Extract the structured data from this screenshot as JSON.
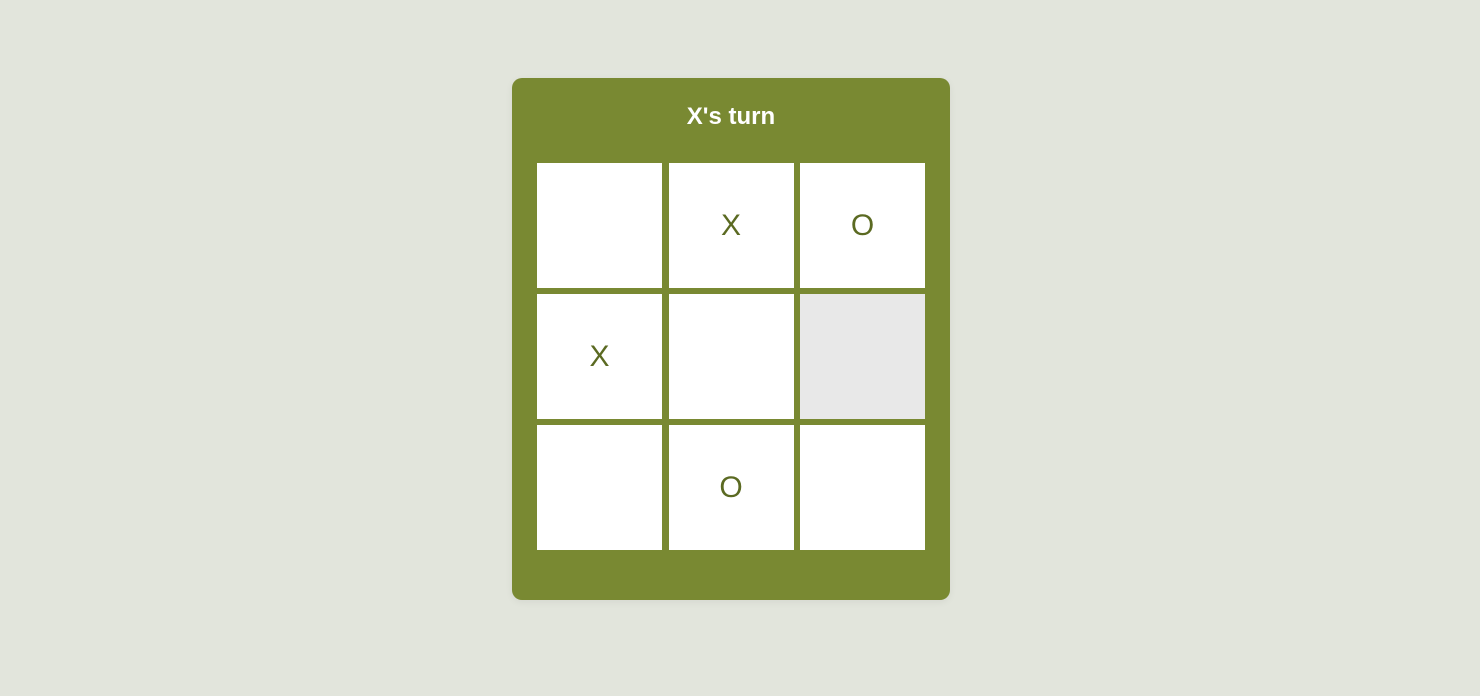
{
  "game": {
    "status": "X's turn",
    "colors": {
      "background": "#e2e5dc",
      "panel": "#798932",
      "cell": "#ffffff",
      "cell_hover": "#e8e8e8",
      "mark": "#5b6a22",
      "status_text": "#ffffff"
    },
    "board": {
      "cells": [
        "",
        "X",
        "O",
        "X",
        "",
        "",
        "",
        "O",
        ""
      ],
      "highlighted_cell": 5
    }
  }
}
